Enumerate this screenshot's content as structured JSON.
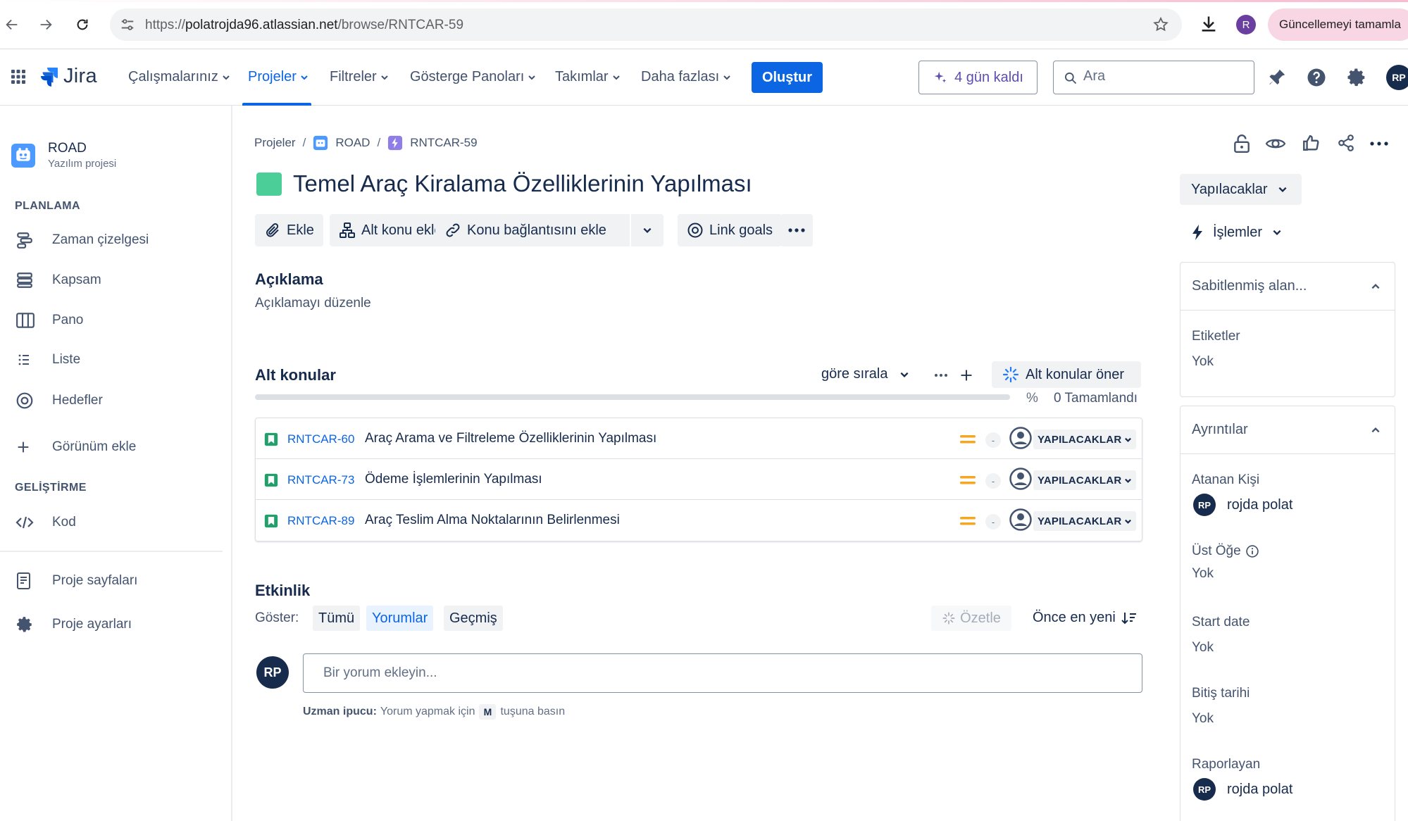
{
  "browser": {
    "url_prefix": "https://",
    "url_host": "polatrojda96.atlassian.net",
    "url_path": "/browse/RNTCAR-59",
    "profile_initial": "R",
    "update_button": "Güncellemeyi tamamla"
  },
  "topnav": {
    "logo": "Jira",
    "items": [
      "Çalışmalarınız",
      "Projeler",
      "Filtreler",
      "Gösterge Panoları",
      "Takımlar",
      "Daha fazlası"
    ],
    "active_item": "Projeler",
    "create": "Oluştur",
    "trial": "4 gün kaldı",
    "search_placeholder": "Ara",
    "avatar": "RP"
  },
  "sidebar": {
    "project_name": "ROAD",
    "project_type": "Yazılım projesi",
    "planning_title": "PLANLAMA",
    "planning_items": [
      "Zaman çizelgesi",
      "Kapsam",
      "Pano",
      "Liste",
      "Hedefler"
    ],
    "add_view": "Görünüm ekle",
    "dev_title": "GELİŞTİRME",
    "dev_items": [
      "Kod"
    ],
    "bottom_items": [
      "Proje sayfaları",
      "Proje ayarları"
    ]
  },
  "breadcrumb": [
    "Projeler",
    "ROAD",
    "RNTCAR-59"
  ],
  "issue": {
    "title": "Temel Araç Kiralama Özelliklerinin Yapılması",
    "color": "#4bce97",
    "actions": [
      "Ekle",
      "Alt konu ekle",
      "Konu bağlantısını ekle",
      "Link goals"
    ]
  },
  "description": {
    "heading": "Açıklama",
    "placeholder": "Açıklamayı düzenle"
  },
  "subtasks": {
    "heading": "Alt konular",
    "sort": "göre sırala",
    "suggest": "Alt konular öner",
    "progress_percent_sign": "%",
    "progress_fraction": 0,
    "completed": "0 Tamamlandı",
    "rows": [
      {
        "key": "RNTCAR-60",
        "summary": "Araç Arama ve Filtreleme Özelliklerinin Yapılması",
        "estimate": "-",
        "status": "YAPILACAKLAR"
      },
      {
        "key": "RNTCAR-73",
        "summary": "Ödeme İşlemlerinin Yapılması",
        "estimate": "-",
        "status": "YAPILACAKLAR"
      },
      {
        "key": "RNTCAR-89",
        "summary": "Araç Teslim Alma Noktalarının Belirlenmesi",
        "estimate": "-",
        "status": "YAPILACAKLAR"
      }
    ]
  },
  "activity": {
    "heading": "Etkinlik",
    "show_label": "Göster:",
    "filters": [
      "Tümü",
      "Yorumlar",
      "Geçmiş"
    ],
    "selected_filter": "Yorumlar",
    "summarize": "Özetle",
    "sort": "Önce en yeni",
    "avatar": "RP",
    "comment_placeholder": "Bir yorum ekleyin...",
    "tip_bold": "Uzman ipucu:",
    "tip_before": "Yorum yapmak için",
    "tip_key": "M",
    "tip_after": "tuşuna basın"
  },
  "right": {
    "status": "Yapılacaklar",
    "actions": "İşlemler",
    "pinned": {
      "heading": "Sabitlenmiş alan...",
      "label": "Etiketler",
      "value": "Yok"
    },
    "details": {
      "heading": "Ayrıntılar",
      "assignee_label": "Atanan Kişi",
      "assignee_initials": "RP",
      "assignee": "rojda polat",
      "parent_label": "Üst Öğe",
      "parent_value": "Yok",
      "start_label": "Start date",
      "start_value": "Yok",
      "due_label": "Bitiş tarihi",
      "due_value": "Yok",
      "reporter_label": "Raporlayan",
      "reporter_initials": "RP",
      "reporter": "rojda polat"
    }
  }
}
